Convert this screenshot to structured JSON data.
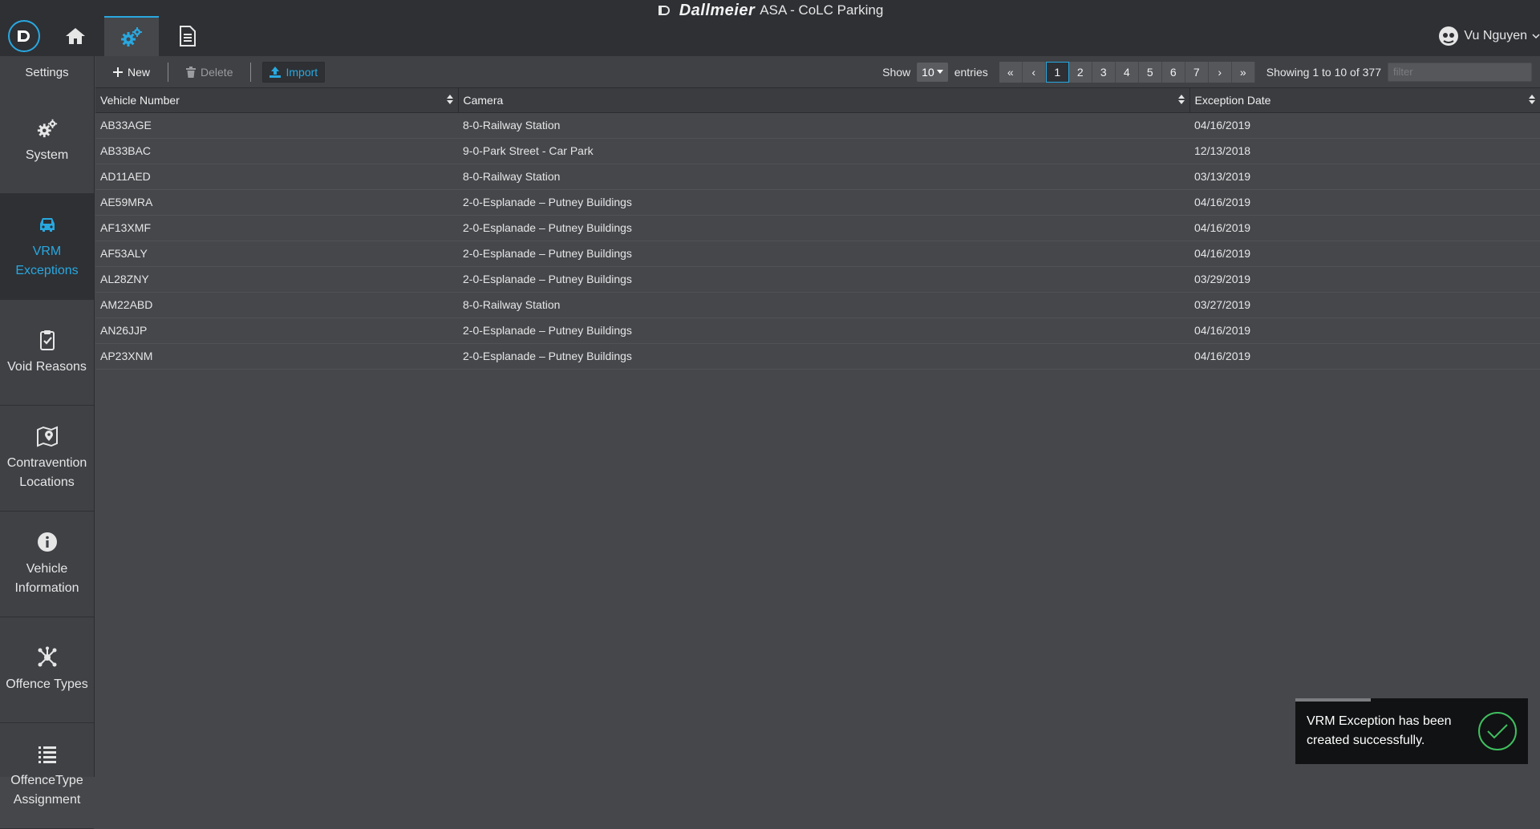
{
  "app": {
    "brand_name": "Dallmeier",
    "title_suffix": "ASA - CoLC Parking",
    "user_name": "Vu Nguyen"
  },
  "topnav": {
    "icons": [
      "home-icon",
      "gears-icon",
      "document-icon"
    ],
    "active": "gears-icon"
  },
  "sidebar": {
    "title": "Settings",
    "items": [
      {
        "label": "System",
        "icon": "gears-icon"
      },
      {
        "label": "VRM\nExceptions",
        "icon": "car-icon",
        "active": true
      },
      {
        "label": "Void Reasons",
        "icon": "clipboard-check-icon"
      },
      {
        "label": "Contravention\nLocations",
        "icon": "map-pin-icon"
      },
      {
        "label": "Vehicle\nInformation",
        "icon": "info-circle-icon"
      },
      {
        "label": "Offence Types",
        "icon": "hub-icon"
      },
      {
        "label": "OffenceType\nAssignment",
        "icon": "list-icon"
      }
    ]
  },
  "toolbar": {
    "new_label": "New",
    "delete_label": "Delete",
    "import_label": "Import",
    "show_label": "Show",
    "entries_value": "10",
    "entries_label": "entries",
    "pages": [
      "«",
      "‹",
      "1",
      "2",
      "3",
      "4",
      "5",
      "6",
      "7",
      "›",
      "»"
    ],
    "active_page": "1",
    "showing_text": "Showing 1 to 10 of 377",
    "filter_placeholder": "filter"
  },
  "table": {
    "columns": [
      "Vehicle Number",
      "Camera",
      "Exception Date"
    ],
    "rows": [
      [
        "AB33AGE",
        "8-0-Railway Station",
        "04/16/2019"
      ],
      [
        "AB33BAC",
        "9-0-Park Street - Car Park",
        "12/13/2018"
      ],
      [
        "AD11AED",
        "8-0-Railway Station",
        "03/13/2019"
      ],
      [
        "AE59MRA",
        "2-0-Esplanade – Putney Buildings",
        "04/16/2019"
      ],
      [
        "AF13XMF",
        "2-0-Esplanade – Putney Buildings",
        "04/16/2019"
      ],
      [
        "AF53ALY",
        "2-0-Esplanade – Putney Buildings",
        "04/16/2019"
      ],
      [
        "AL28ZNY",
        "2-0-Esplanade – Putney Buildings",
        "03/29/2019"
      ],
      [
        "AM22ABD",
        "8-0-Railway Station",
        "03/27/2019"
      ],
      [
        "AN26JJP",
        "2-0-Esplanade – Putney Buildings",
        "04/16/2019"
      ],
      [
        "AP23XNM",
        "2-0-Esplanade – Putney Buildings",
        "04/16/2019"
      ]
    ]
  },
  "toast": {
    "message": "VRM Exception has been created successfully."
  },
  "colors": {
    "accent": "#29a8e0",
    "success": "#3fbf5f"
  }
}
